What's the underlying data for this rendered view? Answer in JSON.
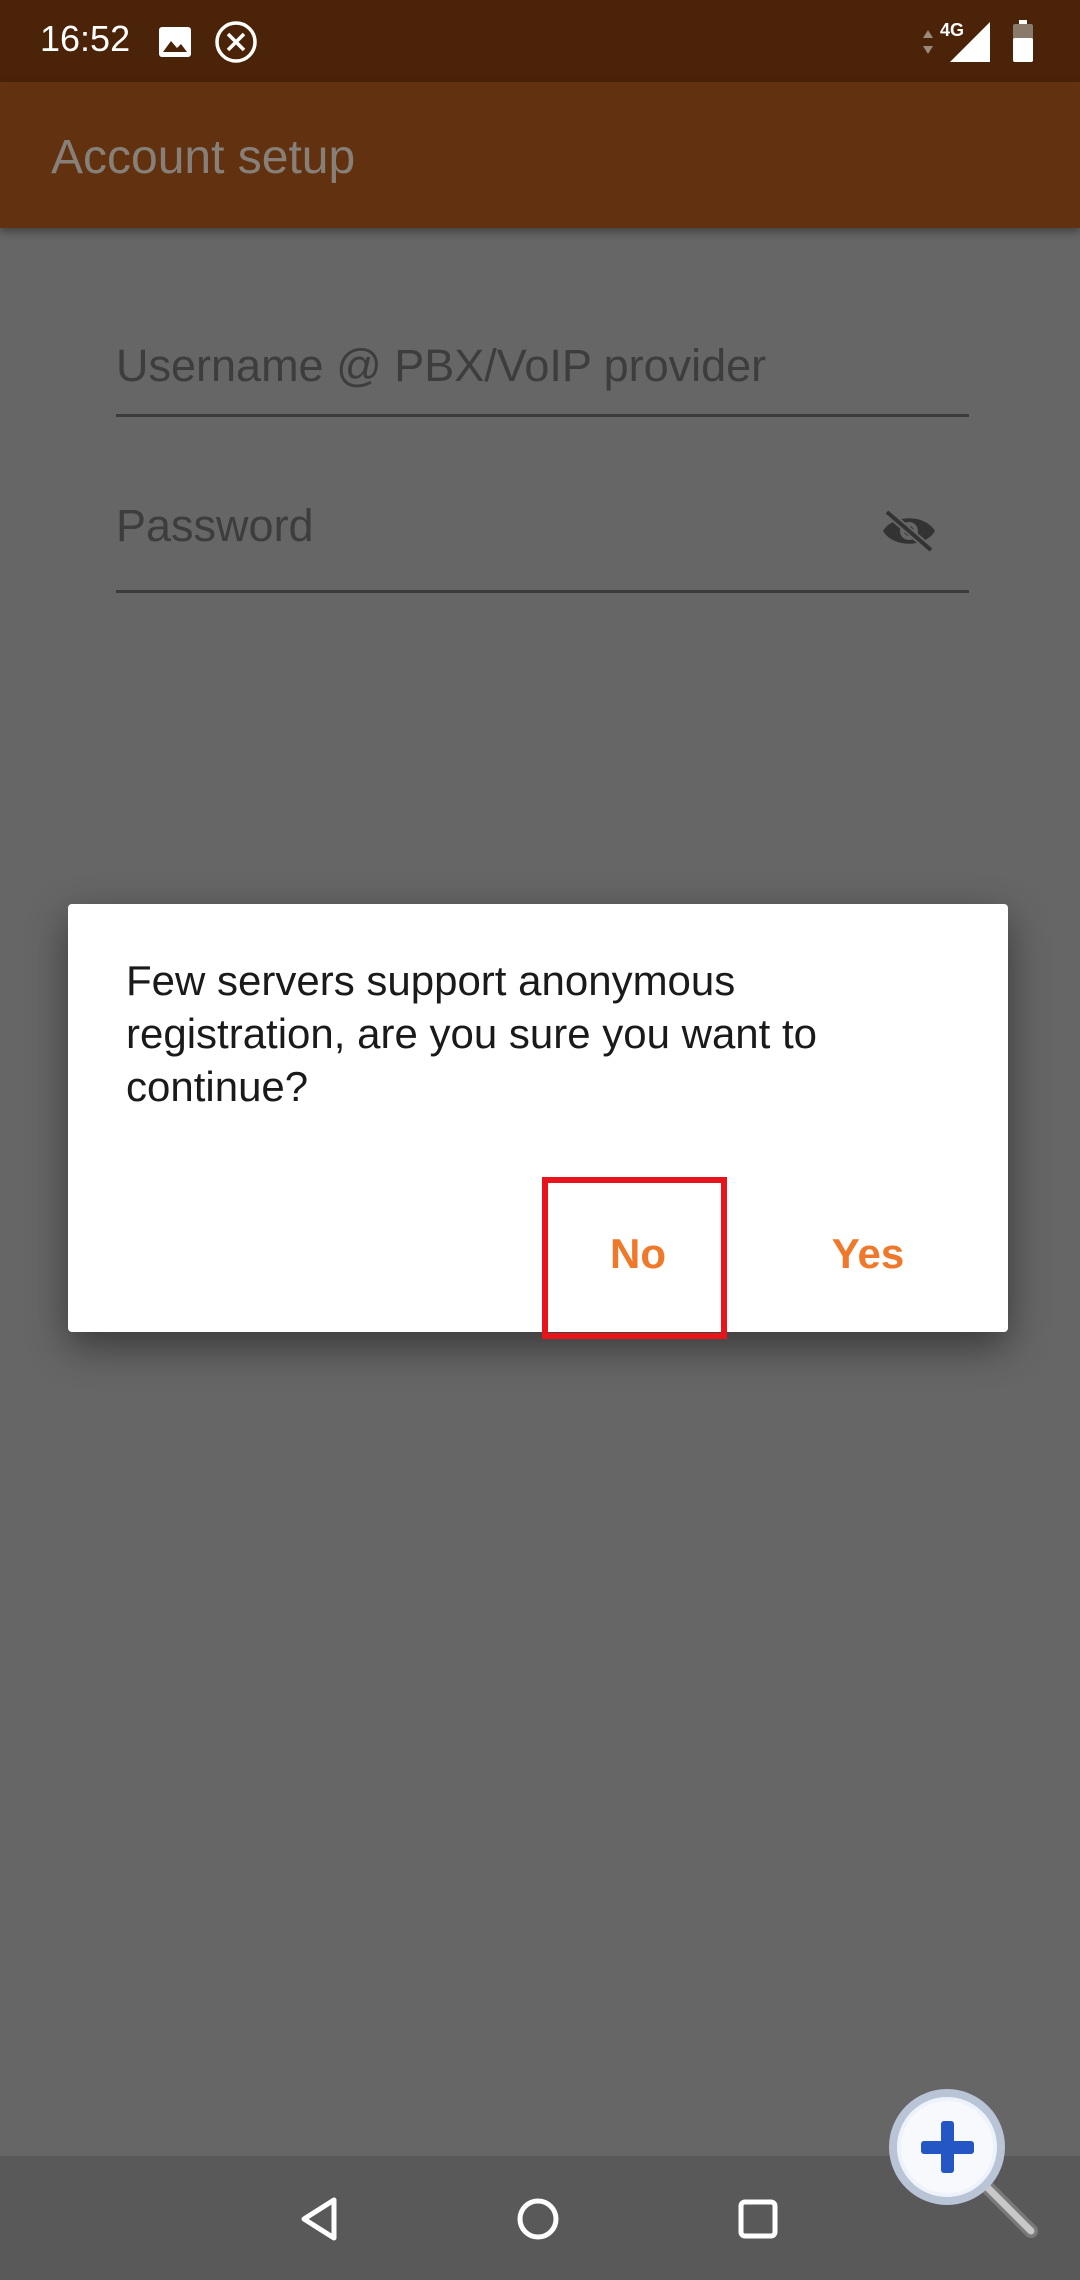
{
  "status_bar": {
    "time": "16:52",
    "network": "4G",
    "icons": [
      "image-icon",
      "close-circle-icon",
      "signal-icon",
      "battery-icon"
    ]
  },
  "app_bar": {
    "title": "Account setup"
  },
  "form": {
    "username_placeholder": "Username @ PBX/VoIP provider",
    "password_placeholder": "Password",
    "password_visibility_icon": "eye-off-icon"
  },
  "dialog": {
    "message": "Few servers support anonymous registration, are you sure you want to continue?",
    "no_label": "No",
    "yes_label": "Yes"
  },
  "nav_bar": {
    "icons": [
      "back-icon",
      "home-icon",
      "recents-icon"
    ]
  },
  "overlay": {
    "icon": "zoom-in-icon"
  },
  "colors": {
    "status_bar": "#4a2308",
    "app_bar": "#623210",
    "scrim": "#666666",
    "accent": "#f0782a",
    "highlight": "#e8141c"
  }
}
